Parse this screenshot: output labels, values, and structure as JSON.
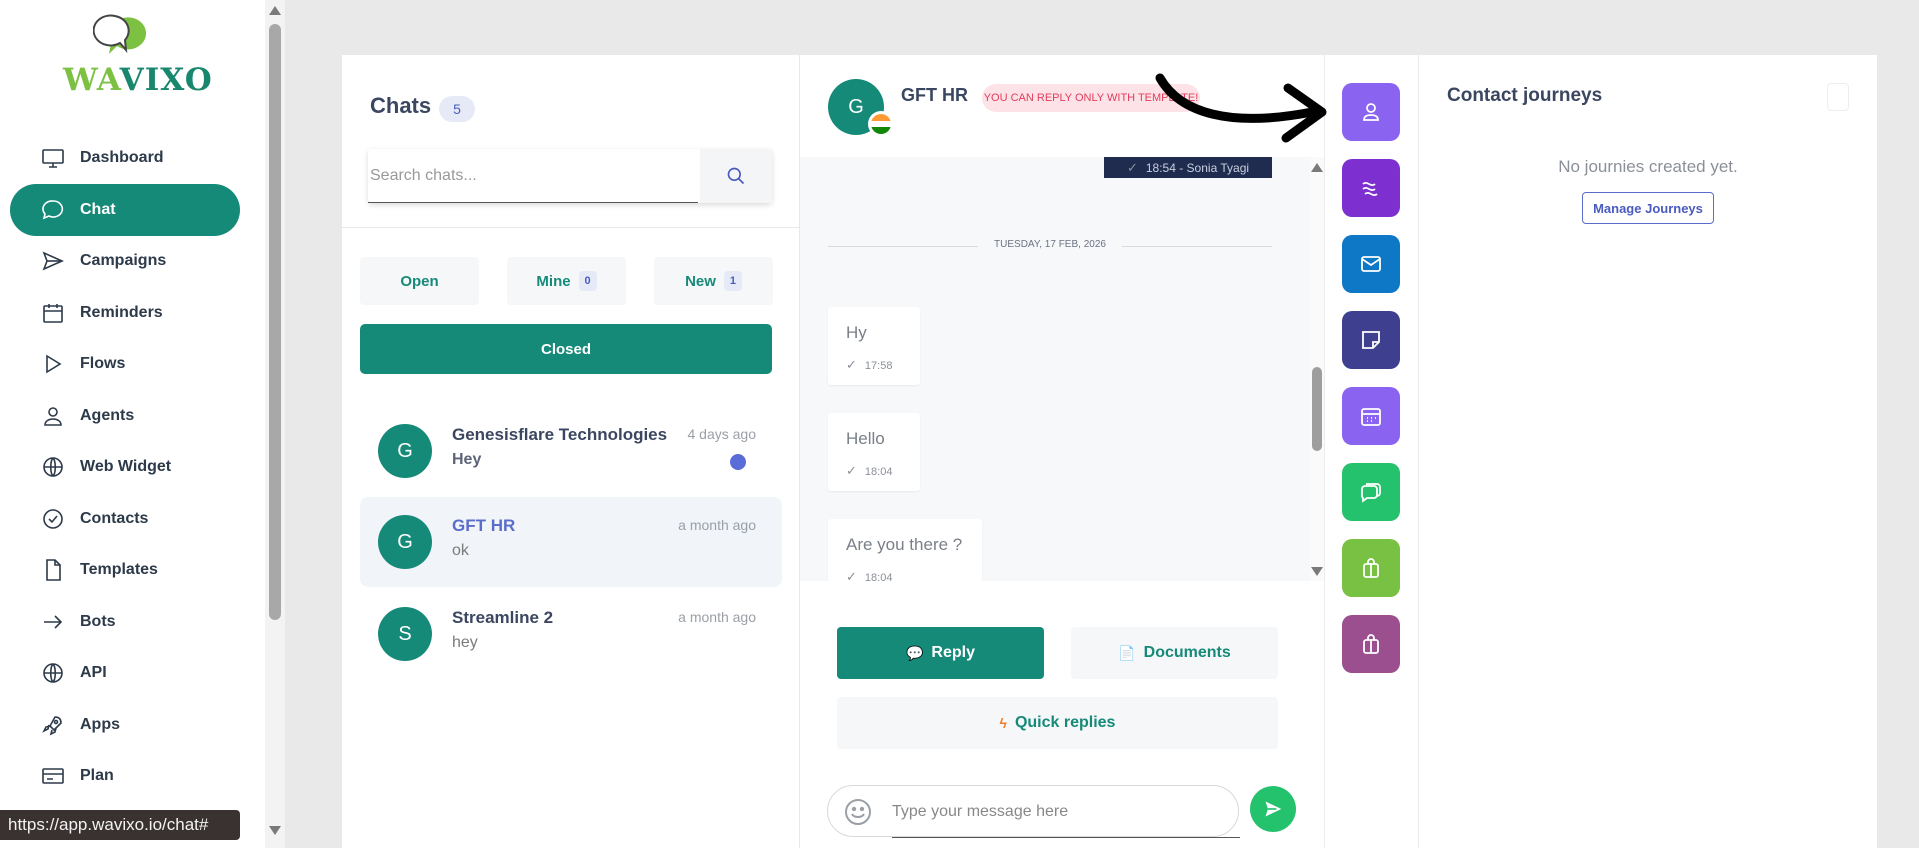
{
  "brand": {
    "logo_wa": "WA",
    "logo_vixo": "VIXO"
  },
  "sidebar": {
    "items": [
      {
        "label": "Dashboard",
        "icon": "monitor-icon"
      },
      {
        "label": "Chat",
        "icon": "chat-bubble-icon",
        "active": true
      },
      {
        "label": "Campaigns",
        "icon": "send-icon"
      },
      {
        "label": "Reminders",
        "icon": "calendar-icon"
      },
      {
        "label": "Flows",
        "icon": "play-icon"
      },
      {
        "label": "Agents",
        "icon": "user-icon"
      },
      {
        "label": "Web Widget",
        "icon": "globe-icon"
      },
      {
        "label": "Contacts",
        "icon": "badge-check-icon"
      },
      {
        "label": "Templates",
        "icon": "file-icon"
      },
      {
        "label": "Bots",
        "icon": "arrow-right-icon"
      },
      {
        "label": "API",
        "icon": "globe-icon"
      },
      {
        "label": "Apps",
        "icon": "rocket-icon"
      },
      {
        "label": "Plan",
        "icon": "credit-card-icon"
      }
    ]
  },
  "status_url": "https://app.wavixo.io/chat#",
  "chats": {
    "title": "Chats",
    "count": "5",
    "search_placeholder": "Search chats...",
    "filters": {
      "open": "Open",
      "mine": "Mine",
      "mine_count": "0",
      "new": "New",
      "new_count": "1",
      "closed": "Closed"
    },
    "list": [
      {
        "initial": "G",
        "name": "Genesisflare Technologies",
        "preview": "Hey",
        "time": "4 days ago",
        "unread": true
      },
      {
        "initial": "G",
        "name": "GFT HR",
        "preview": "ok",
        "time": "a month ago",
        "selected": true
      },
      {
        "initial": "S",
        "name": "Streamline 2",
        "preview": "hey",
        "time": "a month ago"
      }
    ]
  },
  "conversation": {
    "initial": "G",
    "name": "GFT HR",
    "badge": "YOU CAN REPLY ONLY WITH TEMPLATE!",
    "prev_message_meta": "18:54 - Sonia Tyagi",
    "date_separator": "TUESDAY, 17 FEB, 2026",
    "messages": [
      {
        "text": "Hy",
        "time": "17:58"
      },
      {
        "text": "Hello",
        "time": "18:04"
      },
      {
        "text": "Are you there ?",
        "time": "18:04"
      }
    ],
    "reply_label": "Reply",
    "documents_label": "Documents",
    "quick_replies_label": "Quick replies",
    "input_placeholder": "Type your message here"
  },
  "tools": [
    {
      "name": "contact-profile",
      "icon": "user-icon",
      "color": "#8a63f0"
    },
    {
      "name": "journeys",
      "icon": "stripe-wave-icon",
      "color": "#7e2fd0"
    },
    {
      "name": "email",
      "icon": "mail-icon",
      "color": "#0e77c6"
    },
    {
      "name": "notes",
      "icon": "sticky-note-icon",
      "color": "#3f3f8f"
    },
    {
      "name": "calendar",
      "icon": "calendar-icon",
      "color": "#8a63f0"
    },
    {
      "name": "conversations",
      "icon": "chat-bubbles-icon",
      "color": "#25c26e"
    },
    {
      "name": "orders",
      "icon": "shopping-bag-icon",
      "color": "#78c142"
    },
    {
      "name": "store",
      "icon": "shopping-bag-icon",
      "color": "#9b4f8e"
    }
  ],
  "journeys": {
    "title": "Contact journeys",
    "empty_text": "No journies created yet.",
    "manage_label": "Manage Journeys"
  }
}
